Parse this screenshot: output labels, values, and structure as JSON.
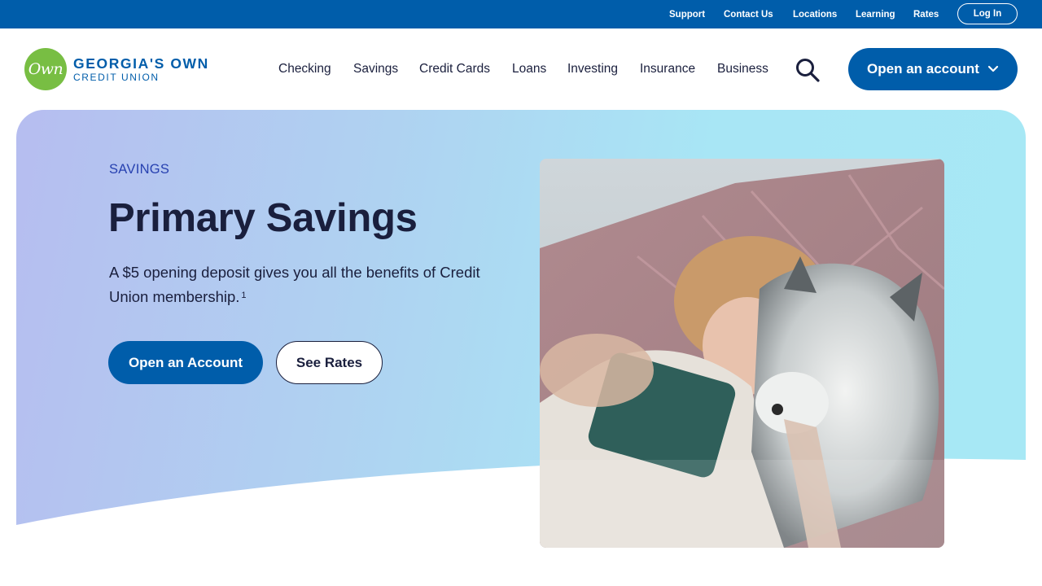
{
  "utility_nav": {
    "support": "Support",
    "contact_us": "Contact Us",
    "locations": "Locations",
    "learning": "Learning",
    "rates": "Rates",
    "login": "Log In"
  },
  "logo": {
    "mark": "Own",
    "line1": "GEORGIA'S OWN",
    "line2": "CREDIT UNION"
  },
  "main_nav": {
    "items": [
      {
        "label": "Checking"
      },
      {
        "label": "Savings"
      },
      {
        "label": "Credit Cards"
      },
      {
        "label": "Loans"
      },
      {
        "label": "Investing"
      },
      {
        "label": "Insurance"
      },
      {
        "label": "Business"
      }
    ],
    "search_icon": "search-icon",
    "cta": "Open an account",
    "cta_icon": "chevron-down-icon"
  },
  "hero": {
    "eyebrow": "SAVINGS",
    "title": "Primary Savings",
    "intro": "A $5 opening deposit gives you all the benefits of Credit Union membership.",
    "intro_footnote": "1",
    "primary_button": "Open an Account",
    "secondary_button": "See Rates",
    "photo_subject": "woman-taking-selfie-with-dog"
  },
  "colors": {
    "brand_blue": "#005daa",
    "logo_green": "#78be43",
    "text_dark": "#1a1f3d",
    "eyebrow_blue": "#2741b0",
    "hero_gradient_start": "#b6bdf0",
    "hero_gradient_end": "#a7e8f5"
  }
}
